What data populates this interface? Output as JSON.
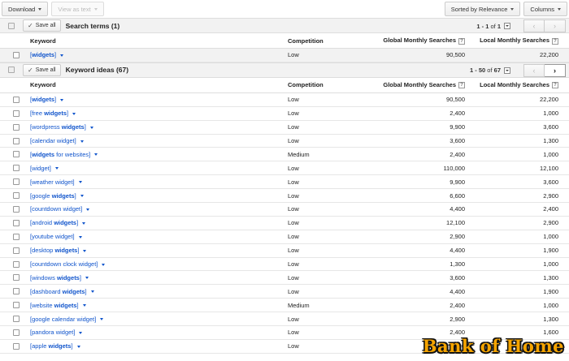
{
  "toolbar": {
    "download_label": "Download",
    "view_as_text_label": "View as text",
    "sorted_label": "Sorted by Relevance",
    "columns_label": "Columns"
  },
  "search_terms": {
    "save_all_label": "Save all",
    "title": "Search terms (1)",
    "pager": {
      "range": "1 - 1",
      "of": "of",
      "total": "1"
    },
    "headers": {
      "keyword": "Keyword",
      "competition": "Competition",
      "global": "Global Monthly Searches",
      "local": "Local Monthly Searches"
    },
    "rows": [
      {
        "parts": [
          {
            "t": "[",
            "b": false
          },
          {
            "t": "widgets",
            "b": true
          },
          {
            "t": "]",
            "b": false
          }
        ],
        "competition": "Low",
        "global": "90,500",
        "local": "22,200"
      }
    ]
  },
  "keyword_ideas": {
    "save_all_label": "Save all",
    "title": "Keyword ideas (67)",
    "pager": {
      "range": "1 - 50",
      "of": "of",
      "total": "67"
    },
    "headers": {
      "keyword": "Keyword",
      "competition": "Competition",
      "global": "Global Monthly Searches",
      "local": "Local Monthly Searches"
    },
    "rows": [
      {
        "parts": [
          {
            "t": "[",
            "b": false
          },
          {
            "t": "widgets",
            "b": true
          },
          {
            "t": "]",
            "b": false
          }
        ],
        "competition": "Low",
        "global": "90,500",
        "local": "22,200"
      },
      {
        "parts": [
          {
            "t": "[free ",
            "b": false
          },
          {
            "t": "widgets",
            "b": true
          },
          {
            "t": "]",
            "b": false
          }
        ],
        "competition": "Low",
        "global": "2,400",
        "local": "1,000"
      },
      {
        "parts": [
          {
            "t": "[wordpress ",
            "b": false
          },
          {
            "t": "widgets",
            "b": true
          },
          {
            "t": "]",
            "b": false
          }
        ],
        "competition": "Low",
        "global": "9,900",
        "local": "3,600"
      },
      {
        "parts": [
          {
            "t": "[calendar widget]",
            "b": false
          }
        ],
        "competition": "Low",
        "global": "3,600",
        "local": "1,300"
      },
      {
        "parts": [
          {
            "t": "[",
            "b": false
          },
          {
            "t": "widgets",
            "b": true
          },
          {
            "t": " for websites]",
            "b": false
          }
        ],
        "competition": "Medium",
        "global": "2,400",
        "local": "1,000"
      },
      {
        "parts": [
          {
            "t": "[widget]",
            "b": false
          }
        ],
        "competition": "Low",
        "global": "110,000",
        "local": "12,100"
      },
      {
        "parts": [
          {
            "t": "[weather widget]",
            "b": false
          }
        ],
        "competition": "Low",
        "global": "9,900",
        "local": "3,600"
      },
      {
        "parts": [
          {
            "t": "[google ",
            "b": false
          },
          {
            "t": "widgets",
            "b": true
          },
          {
            "t": "]",
            "b": false
          }
        ],
        "competition": "Low",
        "global": "6,600",
        "local": "2,900"
      },
      {
        "parts": [
          {
            "t": "[countdown widget]",
            "b": false
          }
        ],
        "competition": "Low",
        "global": "4,400",
        "local": "2,400"
      },
      {
        "parts": [
          {
            "t": "[android ",
            "b": false
          },
          {
            "t": "widgets",
            "b": true
          },
          {
            "t": "]",
            "b": false
          }
        ],
        "competition": "Low",
        "global": "12,100",
        "local": "2,900"
      },
      {
        "parts": [
          {
            "t": "[youtube widget]",
            "b": false
          }
        ],
        "competition": "Low",
        "global": "2,900",
        "local": "1,000"
      },
      {
        "parts": [
          {
            "t": "[desktop ",
            "b": false
          },
          {
            "t": "widgets",
            "b": true
          },
          {
            "t": "]",
            "b": false
          }
        ],
        "competition": "Low",
        "global": "4,400",
        "local": "1,900"
      },
      {
        "parts": [
          {
            "t": "[countdown clock widget]",
            "b": false
          }
        ],
        "competition": "Low",
        "global": "1,300",
        "local": "1,000"
      },
      {
        "parts": [
          {
            "t": "[windows ",
            "b": false
          },
          {
            "t": "widgets",
            "b": true
          },
          {
            "t": "]",
            "b": false
          }
        ],
        "competition": "Low",
        "global": "3,600",
        "local": "1,300"
      },
      {
        "parts": [
          {
            "t": "[dashboard ",
            "b": false
          },
          {
            "t": "widgets",
            "b": true
          },
          {
            "t": "]",
            "b": false
          }
        ],
        "competition": "Low",
        "global": "4,400",
        "local": "1,900"
      },
      {
        "parts": [
          {
            "t": "[website ",
            "b": false
          },
          {
            "t": "widgets",
            "b": true
          },
          {
            "t": "]",
            "b": false
          }
        ],
        "competition": "Medium",
        "global": "2,400",
        "local": "1,000"
      },
      {
        "parts": [
          {
            "t": "[google calendar widget]",
            "b": false
          }
        ],
        "competition": "Low",
        "global": "2,900",
        "local": "1,300"
      },
      {
        "parts": [
          {
            "t": "[pandora widget]",
            "b": false
          }
        ],
        "competition": "Low",
        "global": "2,400",
        "local": "1,600"
      },
      {
        "parts": [
          {
            "t": "[apple ",
            "b": false
          },
          {
            "t": "widgets",
            "b": true
          },
          {
            "t": "]",
            "b": false
          }
        ],
        "competition": "Low",
        "global": "3,600",
        "local": "1,000"
      }
    ]
  },
  "watermark": "Bank of Home"
}
